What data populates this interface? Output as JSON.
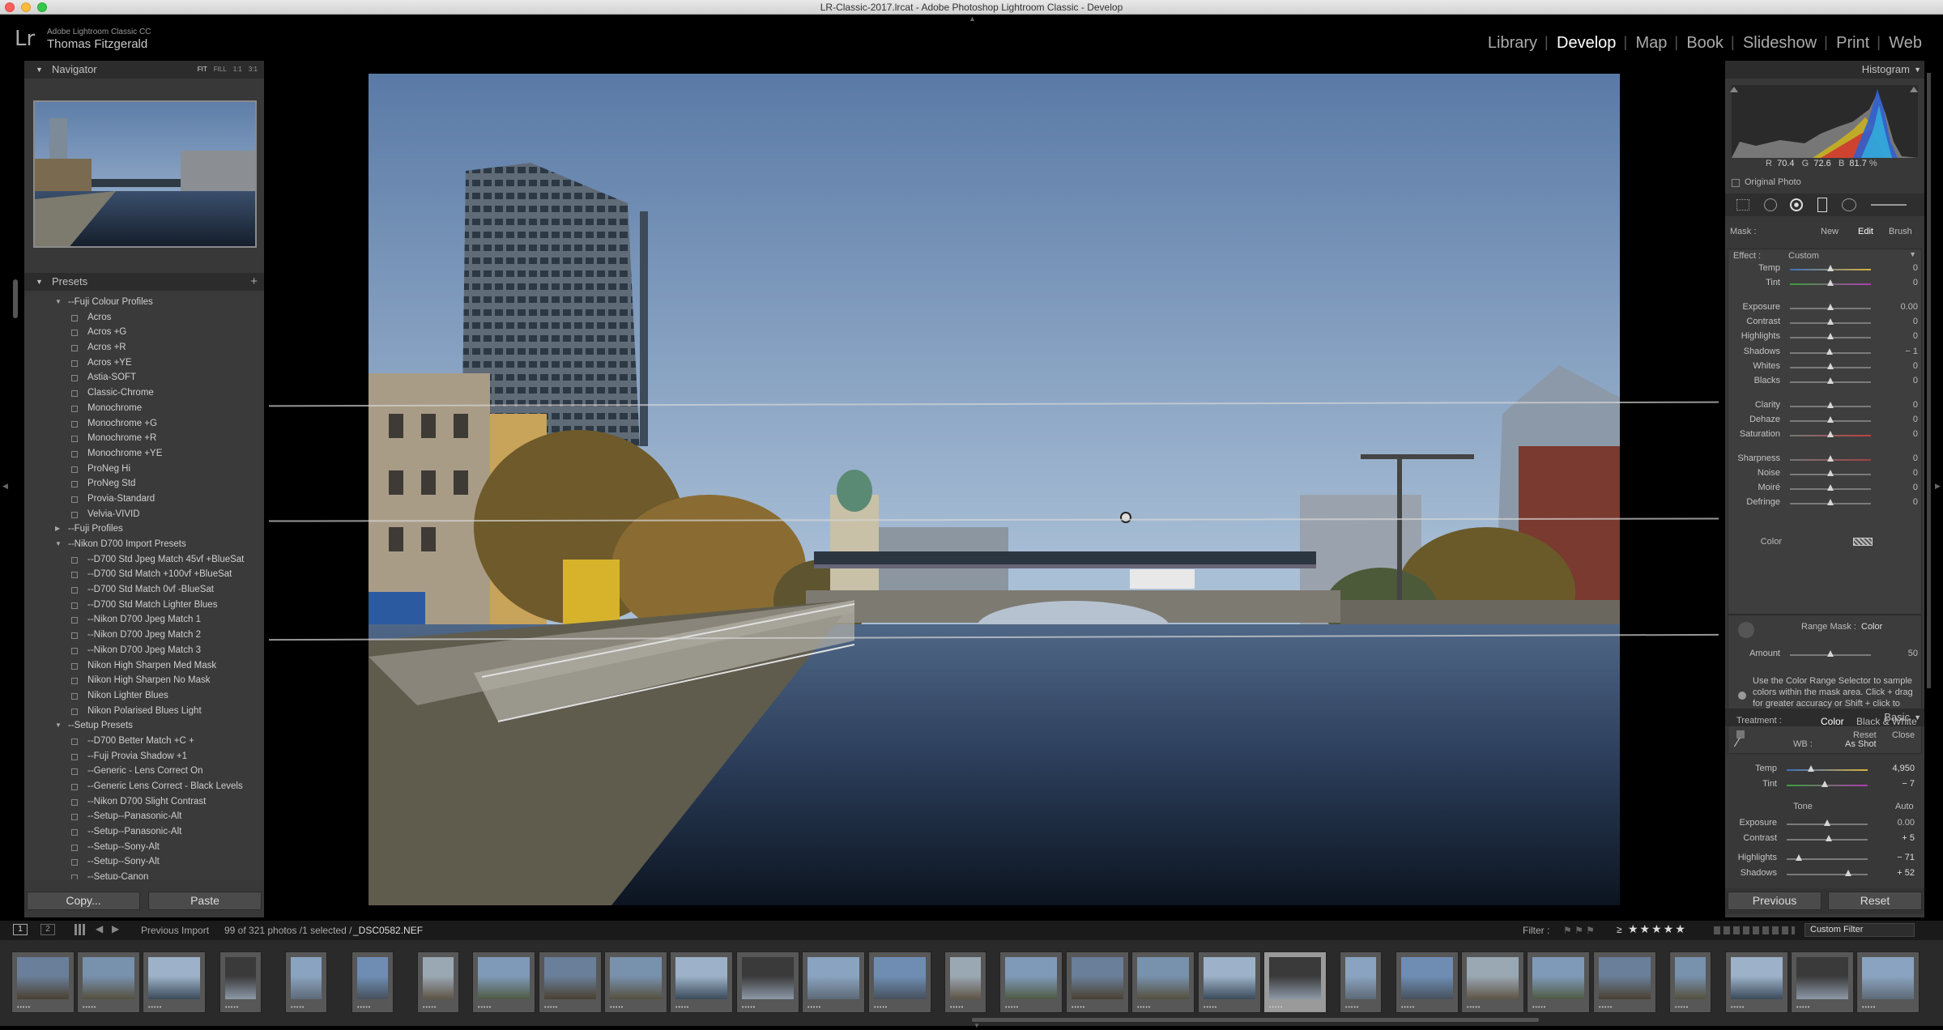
{
  "window": {
    "title": "LR-Classic-2017.lrcat - Adobe Photoshop Lightroom Classic - Develop"
  },
  "identity": {
    "logo": "Lr",
    "app_name": "Adobe Lightroom Classic CC",
    "user_name": "Thomas Fitzgerald"
  },
  "modules": [
    "Library",
    "Develop",
    "Map",
    "Book",
    "Slideshow",
    "Print",
    "Web"
  ],
  "active_module": "Develop",
  "navigator": {
    "title": "Navigator",
    "zoom_options": [
      "FIT",
      "FILL",
      "1:1",
      "3:1"
    ]
  },
  "presets": {
    "title": "Presets",
    "add": "+",
    "items": [
      {
        "type": "folder",
        "label": "--Fuji Colour Profiles",
        "open": true
      },
      {
        "type": "preset",
        "label": "Acros"
      },
      {
        "type": "preset",
        "label": "Acros +G"
      },
      {
        "type": "preset",
        "label": "Acros +R"
      },
      {
        "type": "preset",
        "label": "Acros +YE"
      },
      {
        "type": "preset",
        "label": "Astia-SOFT"
      },
      {
        "type": "preset",
        "label": "Classic-Chrome"
      },
      {
        "type": "preset",
        "label": "Monochrome"
      },
      {
        "type": "preset",
        "label": "Monochrome +G"
      },
      {
        "type": "preset",
        "label": "Monochrome +R"
      },
      {
        "type": "preset",
        "label": "Monochrome +YE"
      },
      {
        "type": "preset",
        "label": "ProNeg Hi"
      },
      {
        "type": "preset",
        "label": "ProNeg Std"
      },
      {
        "type": "preset",
        "label": "Provia-Standard"
      },
      {
        "type": "preset",
        "label": "Velvia-VIVID"
      },
      {
        "type": "folder",
        "label": "--Fuji Profiles",
        "open": false
      },
      {
        "type": "folder",
        "label": "--Nikon D700 Import Presets",
        "open": true
      },
      {
        "type": "preset",
        "label": "--D700 Std Jpeg Match 45vf +BlueSat"
      },
      {
        "type": "preset",
        "label": "--D700 Std Match +100vf +BlueSat"
      },
      {
        "type": "preset",
        "label": "--D700 Std Match 0vf -BlueSat"
      },
      {
        "type": "preset",
        "label": "--D700 Std Match Lighter Blues"
      },
      {
        "type": "preset",
        "label": "--Nikon D700 Jpeg Match 1"
      },
      {
        "type": "preset",
        "label": "--Nikon D700 Jpeg Match 2"
      },
      {
        "type": "preset",
        "label": "--Nikon D700 Jpeg Match 3"
      },
      {
        "type": "preset",
        "label": "Nikon High Sharpen Med Mask"
      },
      {
        "type": "preset",
        "label": "Nikon High Sharpen No Mask"
      },
      {
        "type": "preset",
        "label": "Nikon Lighter Blues"
      },
      {
        "type": "preset",
        "label": "Nikon Polarised Blues Light"
      },
      {
        "type": "folder",
        "label": "--Setup Presets",
        "open": true
      },
      {
        "type": "preset",
        "label": "--D700 Better Match +C +"
      },
      {
        "type": "preset",
        "label": "--Fuji Provia Shadow +1"
      },
      {
        "type": "preset",
        "label": "--Generic - Lens Correct On"
      },
      {
        "type": "preset",
        "label": "--Generic Lens Correct - Black Levels"
      },
      {
        "type": "preset",
        "label": "--Nikon D700 Slight Contrast"
      },
      {
        "type": "preset",
        "label": "--Setup--Panasonic-Alt"
      },
      {
        "type": "preset",
        "label": "--Setup--Panasonic-Alt"
      },
      {
        "type": "preset",
        "label": "--Setup--Sony-Alt"
      },
      {
        "type": "preset",
        "label": "--Setup--Sony-Alt"
      },
      {
        "type": "preset",
        "label": "--Setup-Canon"
      }
    ]
  },
  "left_buttons": {
    "copy": "Copy...",
    "paste": "Paste"
  },
  "histogram": {
    "title": "Histogram",
    "r_label": "R",
    "r_value": "70.4",
    "g_label": "G",
    "g_value": "72.6",
    "b_label": "B",
    "b_value": "81.7",
    "unit": "%",
    "original_photo": "Original Photo"
  },
  "mask": {
    "label": "Mask :",
    "new": "New",
    "edit": "Edit",
    "brush": "Brush",
    "effect_label": "Effect :",
    "effect_value": "Custom",
    "sliders": [
      {
        "label": "Temp",
        "value": "0",
        "pos": 0.5
      },
      {
        "label": "Tint",
        "value": "0",
        "pos": 0.5
      },
      {
        "label": "Exposure",
        "value": "0.00",
        "pos": 0.5
      },
      {
        "label": "Contrast",
        "value": "0",
        "pos": 0.5
      },
      {
        "label": "Highlights",
        "value": "0",
        "pos": 0.5
      },
      {
        "label": "Shadows",
        "value": "− 1",
        "pos": 0.49
      },
      {
        "label": "Whites",
        "value": "0",
        "pos": 0.5
      },
      {
        "label": "Blacks",
        "value": "0",
        "pos": 0.5
      },
      {
        "label": "Clarity",
        "value": "0",
        "pos": 0.5
      },
      {
        "label": "Dehaze",
        "value": "0",
        "pos": 0.5
      },
      {
        "label": "Saturation",
        "value": "0",
        "pos": 0.5
      },
      {
        "label": "Sharpness",
        "value": "0",
        "pos": 0.5
      },
      {
        "label": "Noise",
        "value": "0",
        "pos": 0.5
      },
      {
        "label": "Moiré",
        "value": "0",
        "pos": 0.5
      },
      {
        "label": "Defringe",
        "value": "0",
        "pos": 0.5
      }
    ],
    "color_label": "Color",
    "range_mask_label": "Range Mask :",
    "range_mask_value": "Color",
    "amount_label": "Amount",
    "amount_value": "50",
    "amount_pos": 0.5,
    "help_text": "Use the Color Range Selector to sample colors within the mask area. Click + drag for greater accuracy or Shift + click to add multiple samples.",
    "reset": "Reset",
    "close": "Close"
  },
  "basic": {
    "title": "Basic",
    "treatment_label": "Treatment :",
    "color": "Color",
    "bw": "Black & White",
    "wb_label": "WB :",
    "wb_value": "As Shot",
    "temp_label": "Temp",
    "temp_value": "4,950",
    "temp_pos": 0.3,
    "tint_label": "Tint",
    "tint_value": "− 7",
    "tint_pos": 0.47,
    "tone_label": "Tone",
    "auto": "Auto",
    "exposure_label": "Exposure",
    "exposure_value": "0.00",
    "exposure_pos": 0.5,
    "contrast_label": "Contrast",
    "contrast_value": "+ 5",
    "contrast_pos": 0.52,
    "highlights_label": "Highlights",
    "highlights_value": "− 71",
    "highlights_pos": 0.15,
    "shadows_label": "Shadows",
    "shadows_value": "+ 52",
    "shadows_pos": 0.76
  },
  "right_buttons": {
    "previous": "Previous",
    "reset": "Reset"
  },
  "filmstrip_bar": {
    "page1": "1",
    "page2": "2",
    "source": "Previous Import",
    "info": "99 of 321 photos /1 selected /",
    "filename": "_DSC0582.NEF",
    "filter_label": "Filter :",
    "rating_op": "≥",
    "stars": "★★★★★",
    "custom_filter": "Custom Filter"
  },
  "filmstrip": {
    "count": 29,
    "selected_index": 19,
    "stars": "•••••"
  },
  "colors": {
    "panel_bg": "#383838",
    "header_bg": "#2c2c2c",
    "active_text": "#ffffff",
    "sky_top": "#5a7aa6",
    "sky_bottom": "#a9bfd6"
  }
}
